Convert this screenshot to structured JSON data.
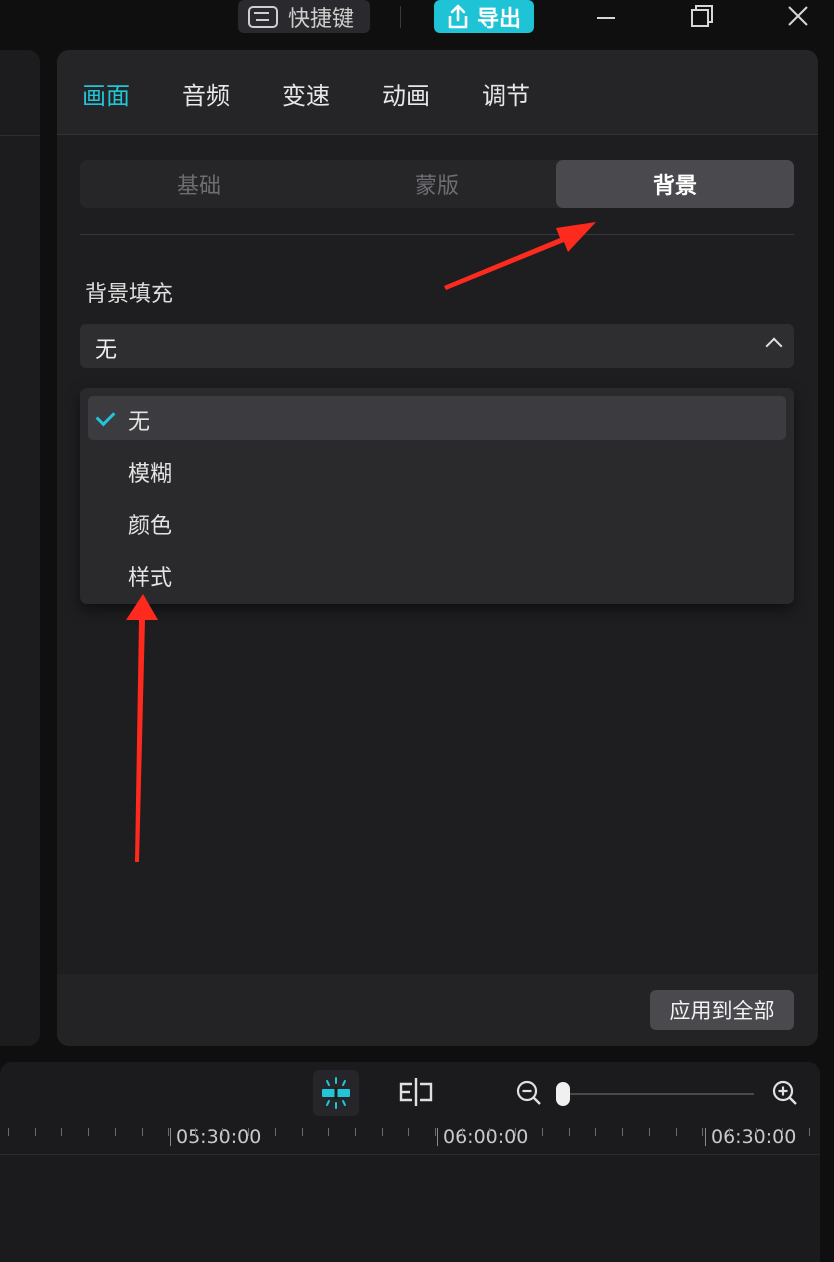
{
  "topbar": {
    "shortcut_label": "快捷键",
    "export_label": "导出",
    "minimize_icon": "minimize-icon",
    "restore_icon": "restore-icon",
    "close_icon": "close-icon"
  },
  "tabs": [
    {
      "label": "画面",
      "active": true
    },
    {
      "label": "音频",
      "active": false
    },
    {
      "label": "变速",
      "active": false
    },
    {
      "label": "动画",
      "active": false
    },
    {
      "label": "调节",
      "active": false
    }
  ],
  "subtabs": [
    {
      "label": "基础",
      "active": false
    },
    {
      "label": "蒙版",
      "active": false
    },
    {
      "label": "背景",
      "active": true
    }
  ],
  "background": {
    "section_label": "背景填充",
    "selected_value": "无",
    "options": [
      {
        "label": "无",
        "selected": true
      },
      {
        "label": "模糊",
        "selected": false
      },
      {
        "label": "颜色",
        "selected": false
      },
      {
        "label": "样式",
        "selected": false
      }
    ]
  },
  "footer": {
    "apply_all_label": "应用到全部"
  },
  "timeline": {
    "ruler_labels": [
      "05:30:00",
      "06:00:00",
      "06:30:00"
    ]
  },
  "colors": {
    "accent": "#22c5d8",
    "annotation_arrow": "#ff2a1e"
  }
}
